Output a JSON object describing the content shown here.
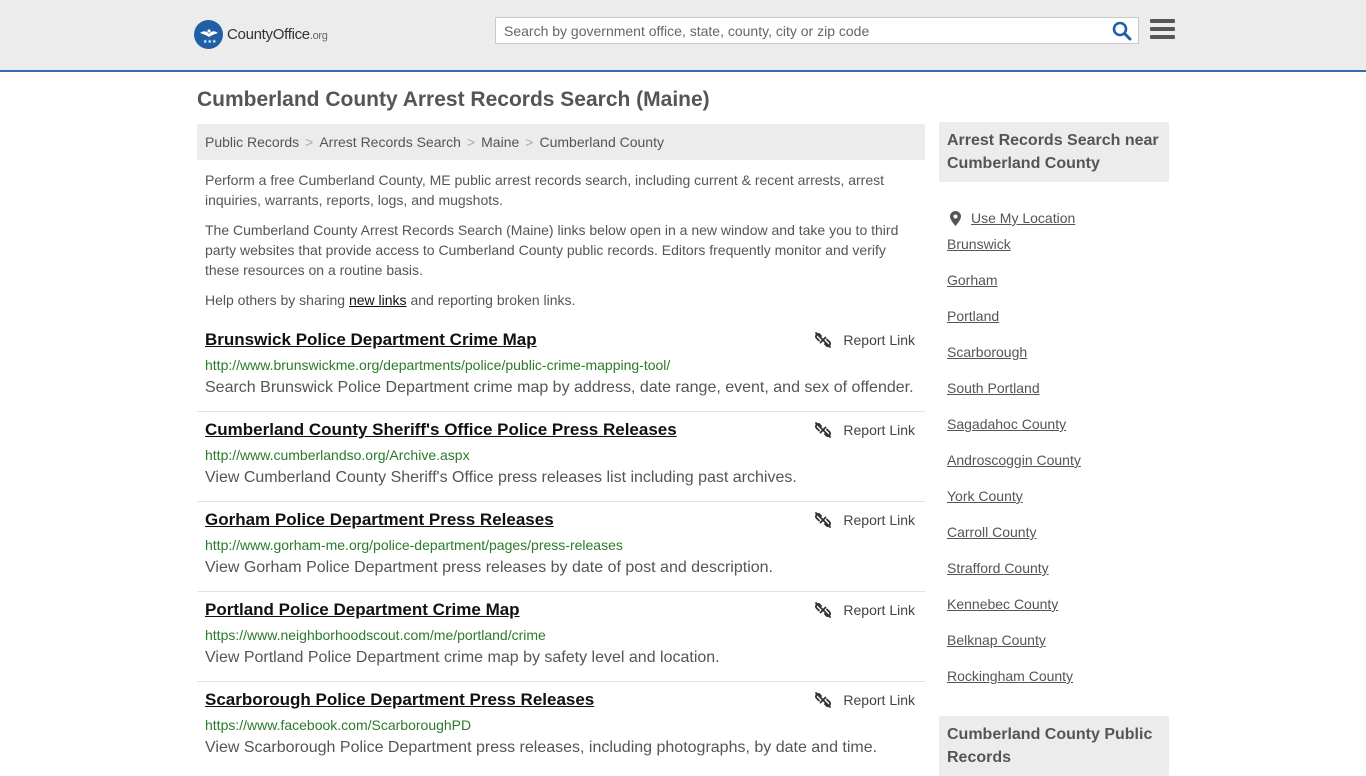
{
  "header": {
    "logo_county": "County",
    "logo_office": "Office",
    "logo_org": ".org",
    "search_placeholder": "Search by government office, state, county, city or zip code"
  },
  "page_title": "Cumberland County Arrest Records Search (Maine)",
  "breadcrumb": [
    "Public Records",
    "Arrest Records Search",
    "Maine",
    "Cumberland County"
  ],
  "intro": {
    "p1": "Perform a free Cumberland County, ME public arrest records search, including current & recent arrests, arrest inquiries, warrants, reports, logs, and mugshots.",
    "p2": "The Cumberland County Arrest Records Search (Maine) links below open in a new window and take you to third party websites that provide access to Cumberland County public records. Editors frequently monitor and verify these resources on a routine basis.",
    "p3_before": "Help others by sharing ",
    "p3_link": "new links",
    "p3_after": " and reporting broken links."
  },
  "report_label": "Report Link",
  "results": [
    {
      "title": "Brunswick Police Department Crime Map",
      "url": "http://www.brunswickme.org/departments/police/public-crime-mapping-tool/",
      "desc": "Search Brunswick Police Department crime map by address, date range, event, and sex of offender."
    },
    {
      "title": "Cumberland County Sheriff's Office Police Press Releases",
      "url": "http://www.cumberlandso.org/Archive.aspx",
      "desc": "View Cumberland County Sheriff's Office press releases list including past archives."
    },
    {
      "title": "Gorham Police Department Press Releases",
      "url": "http://www.gorham-me.org/police-department/pages/press-releases",
      "desc": "View Gorham Police Department press releases by date of post and description."
    },
    {
      "title": "Portland Police Department Crime Map",
      "url": "https://www.neighborhoodscout.com/me/portland/crime",
      "desc": "View Portland Police Department crime map by safety level and location."
    },
    {
      "title": "Scarborough Police Department Press Releases",
      "url": "https://www.facebook.com/ScarboroughPD",
      "desc": "View Scarborough Police Department press releases, including photographs, by date and time."
    }
  ],
  "sidebar": {
    "heading": "Arrest Records Search near Cumberland County",
    "use_location": "Use My Location",
    "links": [
      "Brunswick",
      "Gorham",
      "Portland",
      "Scarborough",
      "South Portland",
      "Sagadahoc County",
      "Androscoggin County",
      "York County",
      "Carroll County",
      "Strafford County",
      "Kennebec County",
      "Belknap County",
      "Rockingham County"
    ],
    "heading2": "Cumberland County Public Records"
  },
  "colors": {
    "brand_blue": "#1f5fa6",
    "url_green": "#2a7a2a",
    "panel_gray": "#ececec"
  }
}
